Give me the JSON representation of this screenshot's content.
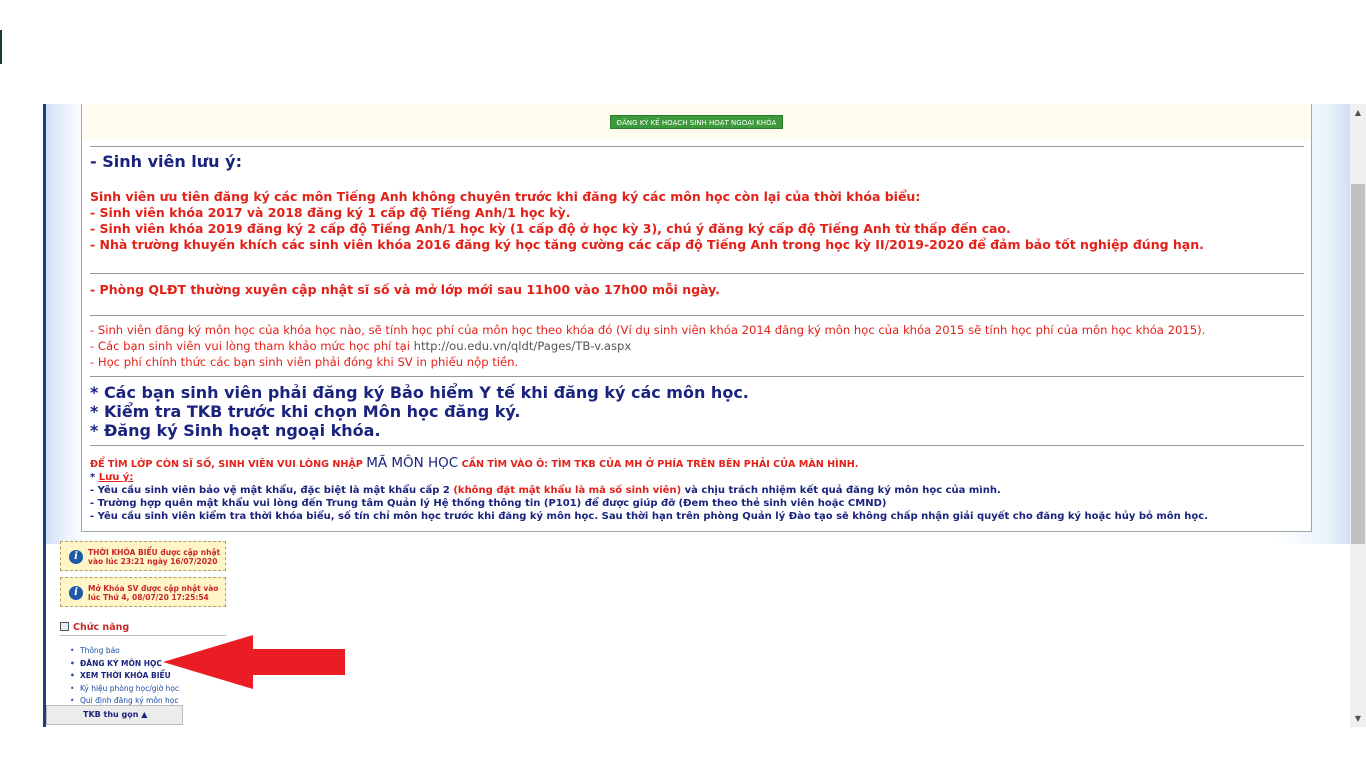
{
  "button": {
    "register_extracurricular": "ĐĂNG KÝ KẾ HOẠCH SINH HOẠT NGOẠI KHÓA"
  },
  "notice": {
    "heading": "- Sinh viên lưu ý:",
    "english_priority": "Sinh viên ưu tiên đăng ký các môn Tiếng Anh không chuyên trước khi đăng ký các môn học còn lại của thời khóa biểu:",
    "english_items": [
      "- Sinh viên khóa 2017 và 2018 đăng ký 1 cấp độ Tiếng Anh/1 học kỳ.",
      "- Sinh viên khóa 2019 đăng ký 2 cấp độ Tiếng Anh/1 học kỳ (1 cấp độ ở học kỳ 3), chú ý đăng ký cấp độ Tiếng Anh từ thấp đến cao.",
      "- Nhà trường khuyến khích các sinh viên khóa 2016 đăng ký học tăng cường các cấp độ Tiếng Anh trong học kỳ II/2019-2020 để đảm bảo tốt nghiệp đúng hạn."
    ],
    "update_schedule": "- Phòng QLĐT thường xuyên cập nhật sĩ số và mở lớp mới sau 11h00 vào 17h00 mỗi ngày.",
    "fee_items": [
      "- Sinh viên đăng ký môn học của khóa học nào, sẽ tính học phí của môn học theo khóa đó (Ví dụ sinh viên khóa 2014 đăng ký môn học của khóa 2015 sẽ tính học phí của môn học khóa 2015).",
      "- Các bạn sinh viên vui lòng tham khảo mức học phí tại ",
      "- Học phí chính thức các bạn sinh viên phải đóng khi SV in phiếu nộp tiền."
    ],
    "fee_url": "http://ou.edu.vn/qldt/Pages/TB-v.aspx",
    "star_items": [
      "* Các bạn sinh viên phải đăng ký Bảo hiểm Y tế khi đăng ký các môn học.",
      "* Kiểm tra TKB trước khi chọn Môn học đăng ký.",
      "* Đăng ký Sinh hoạt ngoại khóa."
    ],
    "find_class_pre": "ĐỂ TÌM LỚP CÒN SĨ SỐ, SINH VIÊN VUI LÒNG NHẬP ",
    "find_class_code": "MÃ MÔN HỌC",
    "find_class_post": " CẦN TÌM VÀO Ô: TÌM TKB CỦA MH Ở PHÍA TRÊN BÊN PHẢI CỦA MÀN HÌNH.",
    "luu_y_star": "* ",
    "luu_y_label": "Lưu ý:",
    "password_pre": "- Yêu cầu sinh viên bảo vệ mật khẩu, đặc biệt là mật khẩu cấp 2 ",
    "password_warn": "(không đặt mật khẩu là mã số sinh viên)",
    "password_post": " và chịu trách nhiệm kết quả đăng ký môn học của mình.",
    "forgot_password": "- Trường hợp quên mật khẩu vui lòng đến Trung tâm Quản lý Hệ thống thông tin (P101) để được giúp đỡ (Đem theo thẻ sinh viên hoặc CMND)",
    "check_schedule": "- Yêu cầu sinh viên kiểm tra thời khóa biểu, số tín chỉ môn học trước khi đăng ký môn học. Sau thời hạn trên phòng Quản lý Đào tạo sẽ không chấp nhận giải quyết cho đăng ký hoặc hủy bỏ môn học."
  },
  "info_boxes": [
    {
      "icon": "info-icon",
      "text": "THỜI KHÓA BIỂU được cập nhật vào lúc 23:21 ngày 16/07/2020"
    },
    {
      "icon": "info-icon",
      "text": "Mở Khóa SV được cập nhật vào lúc Thứ 4, 08/07/20 17:25:54"
    }
  ],
  "functions": {
    "title": "Chức năng",
    "items": [
      "Thông báo",
      "ĐĂNG KÝ MÔN HỌC",
      "XEM THỜI KHÓA BIỂU",
      "Ký hiệu phòng học/giờ học",
      "Qui định đăng ký môn học"
    ]
  },
  "footer_tab": {
    "label": "TKB thu gọn ▲"
  },
  "scrollbar": {
    "up": "▲",
    "down": "▼"
  },
  "colors": {
    "annotation_arrow": "#ea1c24",
    "accent_navy": "#1a237e",
    "alert_red": "#e32119",
    "button_green": "#3c9a3c"
  }
}
